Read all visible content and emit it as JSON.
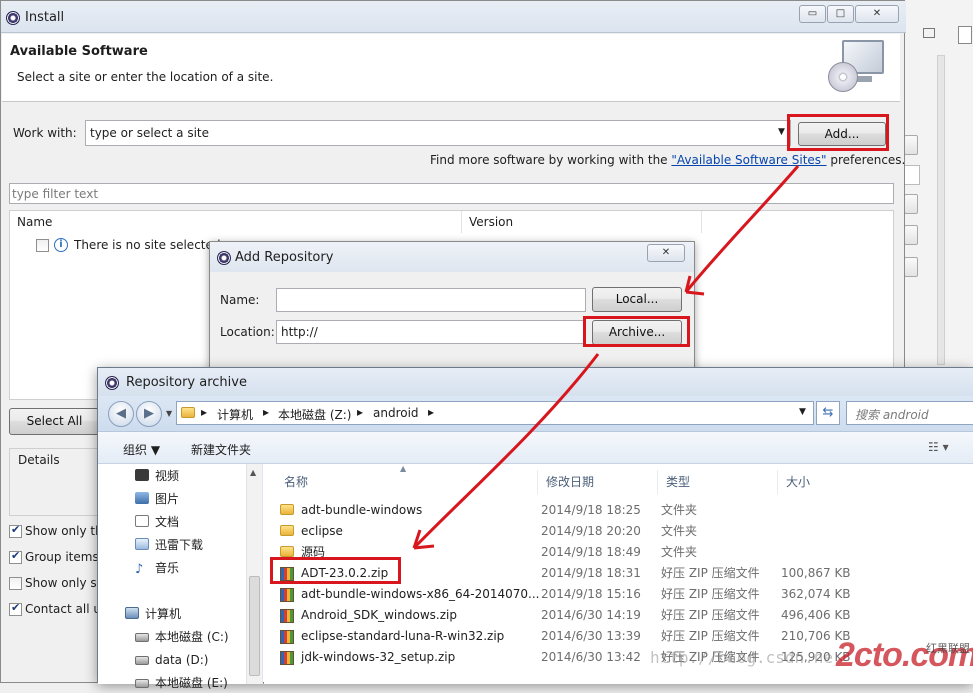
{
  "install": {
    "title": "Install",
    "heading": "Available Software",
    "subheading": "Select a site or enter the location of a site.",
    "work_with_label": "Work with:",
    "work_with_value": "type or select a site",
    "add_button": "Add...",
    "find_more_prefix": "Find more software by working with the ",
    "find_more_link": "\"Available Software Sites\"",
    "find_more_suffix": " preferences.",
    "filter_placeholder": "type filter text",
    "col_name": "Name",
    "col_version": "Version",
    "no_site_text": "There is no site selected.",
    "select_all_button": "Select All",
    "details_label": "Details",
    "options": [
      {
        "label": "Show only th",
        "checked": true
      },
      {
        "label": "Group items",
        "checked": true
      },
      {
        "label": "Show only sc",
        "checked": false
      },
      {
        "label": "Contact all u",
        "checked": true
      }
    ]
  },
  "add_repository": {
    "title": "Add Repository",
    "name_label": "Name:",
    "name_value": "",
    "local_button": "Local...",
    "location_label": "Location:",
    "location_value": "http://",
    "archive_button": "Archive..."
  },
  "archive_dialog": {
    "title": "Repository archive",
    "breadcrumb": [
      "计算机",
      "本地磁盘 (Z:)",
      "android"
    ],
    "search_placeholder": "搜索 android",
    "organize": "组织 ▼",
    "new_folder": "新建文件夹",
    "nav_items": [
      {
        "label": "视频",
        "icon": "video-icon"
      },
      {
        "label": "图片",
        "icon": "picture-icon"
      },
      {
        "label": "文档",
        "icon": "document-icon"
      },
      {
        "label": "迅雷下载",
        "icon": "download-icon"
      },
      {
        "label": "音乐",
        "icon": "music-icon"
      },
      {
        "label": "计算机",
        "icon": "computer-icon"
      },
      {
        "label": "本地磁盘 (C:)",
        "icon": "disk-icon"
      },
      {
        "label": "data (D:)",
        "icon": "disk-icon"
      },
      {
        "label": "本地磁盘 (E:)",
        "icon": "disk-icon"
      }
    ],
    "columns": [
      "名称",
      "修改日期",
      "类型",
      "大小"
    ],
    "files": [
      {
        "name": "adt-bundle-windows",
        "date": "2014/9/18 18:25",
        "type": "文件夹",
        "size": "",
        "kind": "folder"
      },
      {
        "name": "eclipse",
        "date": "2014/9/18 20:20",
        "type": "文件夹",
        "size": "",
        "kind": "folder"
      },
      {
        "name": "源码",
        "date": "2014/9/18 18:49",
        "type": "文件夹",
        "size": "",
        "kind": "folder"
      },
      {
        "name": "ADT-23.0.2.zip",
        "date": "2014/9/18 18:31",
        "type": "好压 ZIP 压缩文件",
        "size": "100,867 KB",
        "kind": "zip"
      },
      {
        "name": "adt-bundle-windows-x86_64-2014070...",
        "date": "2014/9/18 15:16",
        "type": "好压 ZIP 压缩文件",
        "size": "362,074 KB",
        "kind": "zip"
      },
      {
        "name": "Android_SDK_windows.zip",
        "date": "2014/6/30 14:19",
        "type": "好压 ZIP 压缩文件",
        "size": "496,406 KB",
        "kind": "zip"
      },
      {
        "name": "eclipse-standard-luna-R-win32.zip",
        "date": "2014/6/30 13:39",
        "type": "好压 ZIP 压缩文件",
        "size": "210,706 KB",
        "kind": "zip"
      },
      {
        "name": "jdk-windows-32_setup.zip",
        "date": "2014/6/30 13:42",
        "type": "好压 ZIP 压缩文件",
        "size": "125,920 KB",
        "kind": "zip"
      }
    ]
  },
  "watermark": {
    "url": "http://blog.csdn.ne",
    "logo": "2cto.com",
    "logo_sub": "红黑联盟"
  },
  "annotation_color": "#d8161e"
}
